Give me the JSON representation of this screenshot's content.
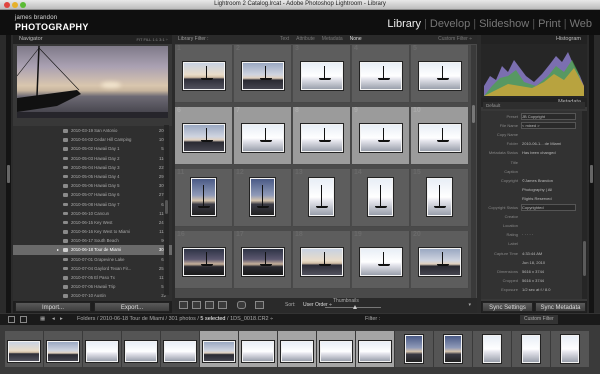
{
  "window": {
    "title": "Lightroom 2 Catalog.lrcat - Adobe Photoshop Lightroom - Library"
  },
  "identity": {
    "line1": "james brandon",
    "line2": "PHOTOGRAPHY"
  },
  "modules": [
    {
      "label": "Library",
      "active": true
    },
    {
      "label": "Develop",
      "active": false
    },
    {
      "label": "Slideshow",
      "active": false
    },
    {
      "label": "Print",
      "active": false
    },
    {
      "label": "Web",
      "active": false
    }
  ],
  "navigator": {
    "title": "Navigator",
    "zoom": "FIT  FILL  1:1  3:1 ÷"
  },
  "folders": [
    {
      "name": "2010-03-19 San Antonio",
      "count": "206"
    },
    {
      "name": "2010-04-02 Cedar Hill Camping",
      "count": "108"
    },
    {
      "name": "2010-05-02 Hawaii Day 1",
      "count": "52"
    },
    {
      "name": "2010-05-03 Hawaii Day 2",
      "count": "116"
    },
    {
      "name": "2010-05-04 Hawaii Day 3",
      "count": "225"
    },
    {
      "name": "2010-05-05 Hawaii Day 4",
      "count": "291"
    },
    {
      "name": "2010-05-06 Hawaii Day 5",
      "count": "309"
    },
    {
      "name": "2010-05-07 Hawaii Day 6",
      "count": "276"
    },
    {
      "name": "2010-05-08 Hawaii Day 7",
      "count": "63"
    },
    {
      "name": "2010-06-10 Cancun",
      "count": "115"
    },
    {
      "name": "2010-06-15 Key West",
      "count": "241"
    },
    {
      "name": "2010-06-16 Key West to Miami",
      "count": "112"
    },
    {
      "name": "2010-06-17 South Beach",
      "count": "96"
    },
    {
      "name": "2010-06-18 Tour de Miami",
      "count": "301",
      "selected": true
    },
    {
      "name": "2010-07-01 Grapevine Lake",
      "count": "63"
    },
    {
      "name": "2010-07-04 Gaylord Texan Fir...",
      "count": "251"
    },
    {
      "name": "2010-07-05 El Paso Tx",
      "count": "117"
    },
    {
      "name": "2010-07-06 Hawaii Trip",
      "count": "51"
    },
    {
      "name": "2010-07-10 Austin",
      "count": "22"
    }
  ],
  "left_buttons": {
    "import": "Import...",
    "export": "Export..."
  },
  "library_filter": {
    "label": "Library Filter :",
    "tabs": [
      "Text",
      "Attribute",
      "Metadata",
      "None"
    ],
    "active_tab": "None",
    "custom": "Custom Filter ÷"
  },
  "grid": {
    "cells": [
      {
        "idx": "1",
        "orient": "land",
        "sky": "sky1",
        "selected": false
      },
      {
        "idx": "2",
        "orient": "land",
        "sky": "sky2",
        "selected": false
      },
      {
        "idx": "3",
        "orient": "land",
        "sky": "sky4",
        "selected": false
      },
      {
        "idx": "4",
        "orient": "land",
        "sky": "sky4",
        "selected": false
      },
      {
        "idx": "5",
        "orient": "land",
        "sky": "sky4",
        "selected": false
      },
      {
        "idx": "6",
        "orient": "land",
        "sky": "sky2",
        "selected": true
      },
      {
        "idx": "7",
        "orient": "land",
        "sky": "sky4",
        "selected": true
      },
      {
        "idx": "8",
        "orient": "land",
        "sky": "sky4",
        "selected": true
      },
      {
        "idx": "9",
        "orient": "land",
        "sky": "sky4",
        "selected": true
      },
      {
        "idx": "10",
        "orient": "land",
        "sky": "sky4",
        "selected": true
      },
      {
        "idx": "11",
        "orient": "port",
        "sky": "sky3",
        "selected": false
      },
      {
        "idx": "12",
        "orient": "port",
        "sky": "sky3",
        "selected": false
      },
      {
        "idx": "13",
        "orient": "port",
        "sky": "sky4",
        "selected": false
      },
      {
        "idx": "14",
        "orient": "port",
        "sky": "sky4",
        "selected": false
      },
      {
        "idx": "15",
        "orient": "port",
        "sky": "sky4",
        "selected": false
      },
      {
        "idx": "16",
        "orient": "land",
        "sky": "sky5",
        "selected": false
      },
      {
        "idx": "17",
        "orient": "land",
        "sky": "sky5",
        "selected": false
      },
      {
        "idx": "18",
        "orient": "land",
        "sky": "sky1",
        "selected": false
      },
      {
        "idx": "19",
        "orient": "land",
        "sky": "sky4",
        "selected": false
      },
      {
        "idx": "20",
        "orient": "land",
        "sky": "sky2",
        "selected": false
      }
    ]
  },
  "toolbar": {
    "sort_label": "Sort:",
    "sort_value": "User Order ÷",
    "thumbnails": "Thumbnails"
  },
  "histogram": {
    "title": "Histogram"
  },
  "metadata": {
    "title": "Metadata",
    "preset_default": "Default",
    "rows": [
      {
        "k": "Preset",
        "v": "JB Copyright",
        "box": true
      },
      {
        "k": "File Name",
        "v": "< mixed >",
        "box": true
      },
      {
        "k": "Copy Name",
        "v": "",
        "box": false
      },
      {
        "k": "Folder",
        "v": "2010-06-1... de Miami",
        "box": false
      },
      {
        "k": "Metadata Status",
        "v": "Has been changed",
        "box": false
      },
      {
        "k": "Title",
        "v": "",
        "box": false
      },
      {
        "k": "Caption",
        "v": "",
        "box": false
      },
      {
        "k": "Copyright",
        "v": "©James Brandon",
        "box": false
      },
      {
        "k": "",
        "v": "Photography | All",
        "box": false
      },
      {
        "k": "",
        "v": "Rights Reserved",
        "box": false
      },
      {
        "k": "Copyright Status",
        "v": "Copyrighted",
        "box": true
      },
      {
        "k": "Creator",
        "v": "",
        "box": false
      },
      {
        "k": "Location",
        "v": "",
        "box": false
      },
      {
        "k": "Rating",
        "v": "· · · · ·",
        "box": false
      },
      {
        "k": "Label",
        "v": "",
        "box": false
      },
      {
        "k": "Capture Time",
        "v": "4:33:44 AM",
        "box": false
      },
      {
        "k": "",
        "v": "Jun 18, 2010",
        "box": false
      },
      {
        "k": "Dimensions",
        "v": "5616 x 3744",
        "box": false
      },
      {
        "k": "Cropped",
        "v": "5616 x 3744",
        "box": false
      },
      {
        "k": "Exposure",
        "v": "1/2 sec at f / 8.0",
        "box": false
      }
    ]
  },
  "right_buttons": {
    "sync_settings": "Sync Settings",
    "sync_metadata": "Sync Metadata"
  },
  "filmstrip_bar": {
    "crumb_prefix": "Folders / 2010-06-18 Tour de Miami / 301 photos / ",
    "crumb_selected": "5 selected",
    "crumb_suffix": " / 1DS_0018.CR2 ÷",
    "filter": "Filter :",
    "custom": "Custom Filter"
  },
  "filmstrip": [
    {
      "orient": "land",
      "sky": "sky1",
      "selected": false
    },
    {
      "orient": "land",
      "sky": "sky2",
      "selected": false
    },
    {
      "orient": "land",
      "sky": "sky4",
      "selected": false
    },
    {
      "orient": "land",
      "sky": "sky4",
      "selected": false
    },
    {
      "orient": "land",
      "sky": "sky4",
      "selected": false
    },
    {
      "orient": "land",
      "sky": "sky2",
      "selected": true
    },
    {
      "orient": "land",
      "sky": "sky4",
      "selected": true
    },
    {
      "orient": "land",
      "sky": "sky4",
      "selected": true
    },
    {
      "orient": "land",
      "sky": "sky4",
      "selected": true
    },
    {
      "orient": "land",
      "sky": "sky4",
      "selected": true
    },
    {
      "orient": "port",
      "sky": "sky3",
      "selected": false
    },
    {
      "orient": "port",
      "sky": "sky3",
      "selected": false
    },
    {
      "orient": "port",
      "sky": "sky4",
      "selected": false
    },
    {
      "orient": "port",
      "sky": "sky4",
      "selected": false
    },
    {
      "orient": "port",
      "sky": "sky4",
      "selected": false
    }
  ],
  "colors": {
    "accent": "#6a6a6a",
    "panel": "#383838",
    "grid_selected": "#9b9b9b"
  }
}
